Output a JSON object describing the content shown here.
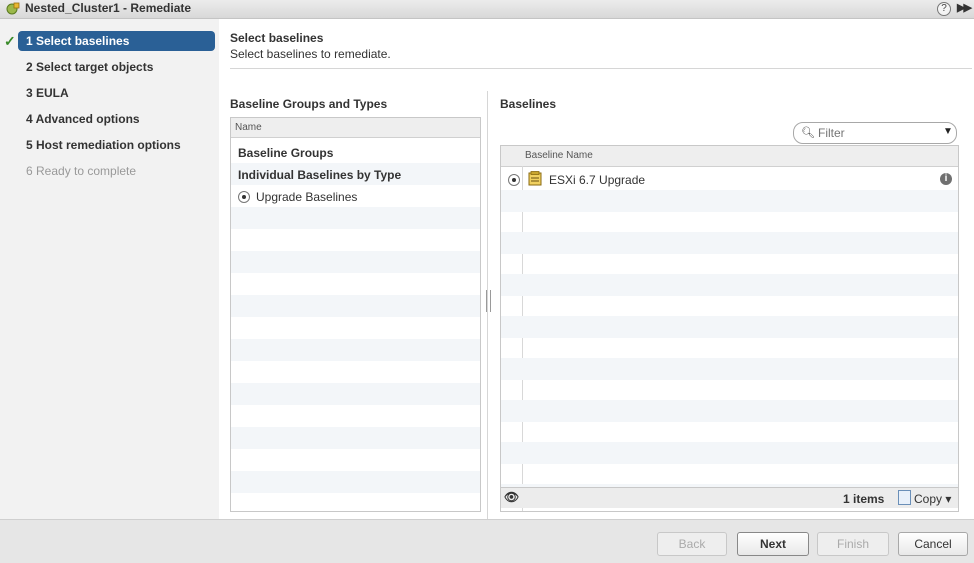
{
  "window": {
    "title": "Nested_Cluster1 - Remediate",
    "help_icon": "question-circle-icon",
    "more_icon": "double-chevron-right-icon"
  },
  "wizard": {
    "steps": [
      {
        "label": "1  Select baselines",
        "state": "active"
      },
      {
        "label": "2  Select target objects",
        "state": "normal"
      },
      {
        "label": "3  EULA",
        "state": "normal"
      },
      {
        "label": "4  Advanced options",
        "state": "normal"
      },
      {
        "label": "5  Host remediation options",
        "state": "normal"
      },
      {
        "label": "6  Ready to complete",
        "state": "disabled"
      }
    ]
  },
  "page": {
    "title": "Select baselines",
    "subtitle": "Select baselines to remediate."
  },
  "groups_panel": {
    "title": "Baseline Groups and Types",
    "column_header": "Name",
    "rows": [
      {
        "label": "Baseline Groups"
      },
      {
        "label": "Individual Baselines by Type"
      },
      {
        "label": "Upgrade Baselines",
        "selected": true
      }
    ]
  },
  "baselines_panel": {
    "title": "Baselines",
    "filter_placeholder": "Filter",
    "column_header": "Baseline Name",
    "rows": [
      {
        "name": "ESXi 6.7 Upgrade",
        "selected": true
      }
    ],
    "item_count": "1 items",
    "copy_label": "Copy"
  },
  "buttons": {
    "back": "Back",
    "next": "Next",
    "finish": "Finish",
    "cancel": "Cancel"
  },
  "colors": {
    "active_step": "#2a6096",
    "check": "#3a8b2a"
  }
}
